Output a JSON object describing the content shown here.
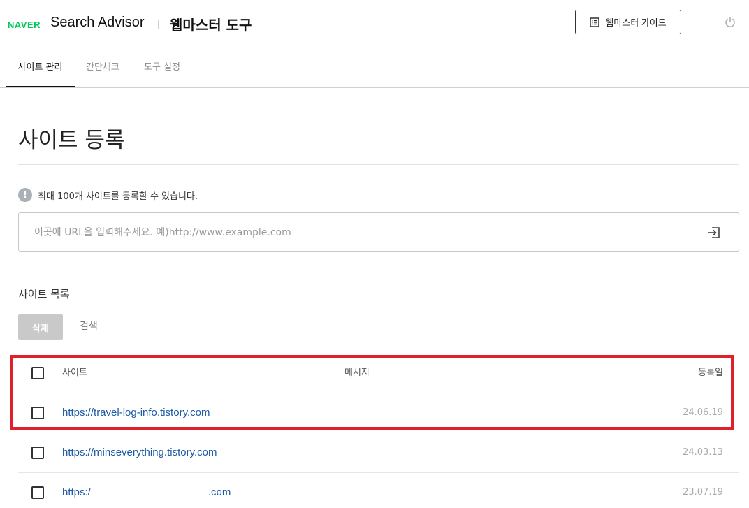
{
  "header": {
    "logo_text": "NAVER",
    "app_name": "Search Advisor",
    "tool_title": "웹마스터 도구",
    "guide_button_label": "웹마스터 가이드",
    "guide_icon": "document-list-icon",
    "logout_icon": "power-icon"
  },
  "tabs": [
    {
      "label": "사이트 관리",
      "active": true
    },
    {
      "label": "간단체크",
      "active": false
    },
    {
      "label": "도구 설정",
      "active": false
    }
  ],
  "main": {
    "page_title": "사이트 등록",
    "notice_icon_text": "!",
    "notice_text": "최대 100개 사이트를 등록할 수 있습니다.",
    "url_input": {
      "value": "",
      "placeholder": "이곳에 URL을 입력해주세요. 예)http://www.example.com"
    },
    "submit_icon": "enter-arrow-icon"
  },
  "site_list": {
    "title": "사이트 목록",
    "delete_label": "삭제",
    "search_placeholder": "검색",
    "columns": {
      "site": "사이트",
      "message": "메시지",
      "registered": "등록일"
    },
    "rows": [
      {
        "site": "https://travel-log-info.tistory.com",
        "message": "",
        "date": "24.06.19"
      },
      {
        "site": "https://minseverything.tistory.com",
        "message": "",
        "date": "24.03.13"
      },
      {
        "site_prefix": "https:/",
        "site_suffix": ".com",
        "message": "",
        "date": "23.07.19"
      }
    ]
  },
  "colors": {
    "naver_green": "#03c75a",
    "link_blue": "#1b5aa5",
    "highlight_red": "#e0202a",
    "disabled_button": "#c9c9c9"
  }
}
